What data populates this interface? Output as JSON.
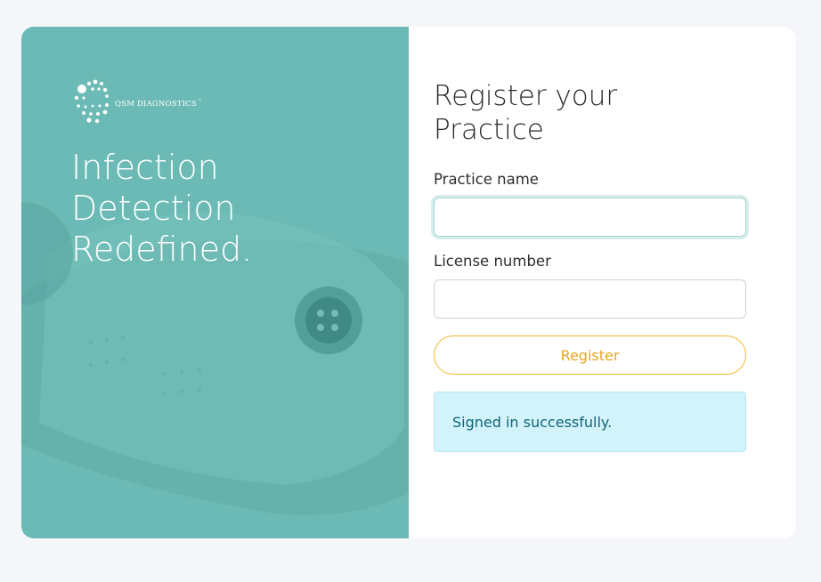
{
  "brand": {
    "logo_text": "QSM DIAGNOSTICS",
    "trademark": "™"
  },
  "hero": {
    "headline_lines": [
      "Infection",
      "Detection",
      "Redefined."
    ]
  },
  "form": {
    "title_lines": [
      "Register your",
      "Practice"
    ],
    "practice_name": {
      "label": "Practice name",
      "value": "",
      "placeholder": ""
    },
    "license_number": {
      "label": "License number",
      "value": "",
      "placeholder": ""
    },
    "register_label": "Register"
  },
  "alert": {
    "message": "Signed in successfully."
  },
  "colors": {
    "page_bg": "#f4f6fa",
    "hero_teal": "#6cbab5",
    "accent_gold": "#f1b72a",
    "alert_bg": "#d3f3fb",
    "alert_text": "#0f6577"
  }
}
